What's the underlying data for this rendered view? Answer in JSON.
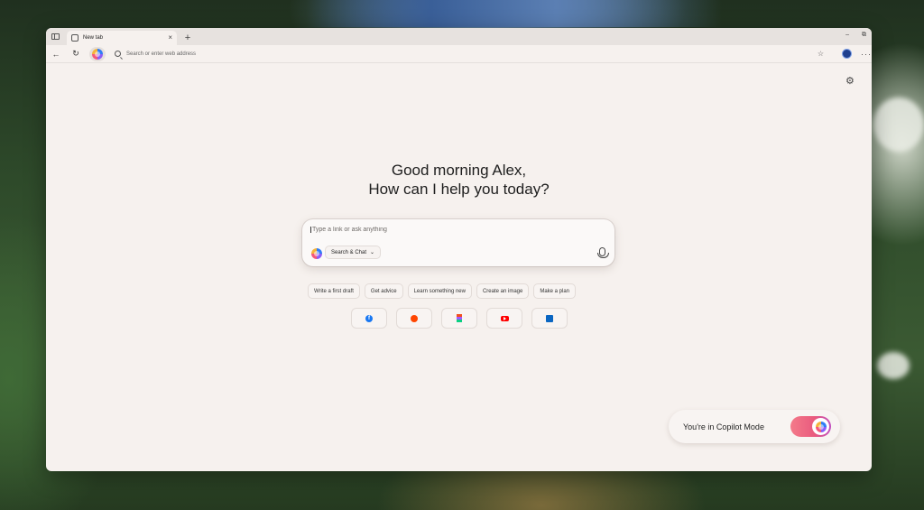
{
  "browser": {
    "tab": {
      "title": "New tab",
      "close_label": "×"
    },
    "new_tab_label": "+",
    "window_controls": {
      "minimize": "–",
      "restore": "⧉"
    },
    "address_bar": {
      "placeholder": "Search or enter web address"
    },
    "nav": {
      "back": "←",
      "refresh": "↻"
    },
    "favorites_label": "☆",
    "more_label": "···"
  },
  "page": {
    "settings_label": "⚙",
    "greeting_line1": "Good morning Alex,",
    "greeting_line2": "How can I help you today?",
    "chat": {
      "placeholder": "Type a link or ask anything",
      "mode_label": "Search & Chat",
      "mode_chevron": "⌄"
    },
    "suggestions": [
      "Write a first draft",
      "Get advice",
      "Learn something new",
      "Create an image",
      "Make a plan"
    ],
    "shortcuts": [
      {
        "name": "facebook",
        "glyph": "f"
      },
      {
        "name": "reddit",
        "glyph": ""
      },
      {
        "name": "figma",
        "glyph": ""
      },
      {
        "name": "youtube",
        "glyph": ""
      },
      {
        "name": "linkedin",
        "glyph": ""
      }
    ],
    "copilot_mode": {
      "label": "You're in Copilot Mode",
      "enabled": true
    }
  },
  "colors": {
    "toggle_gradient_start": "#f47a8a",
    "toggle_gradient_end": "#c04ec0",
    "page_background": "#f6f1ee"
  }
}
